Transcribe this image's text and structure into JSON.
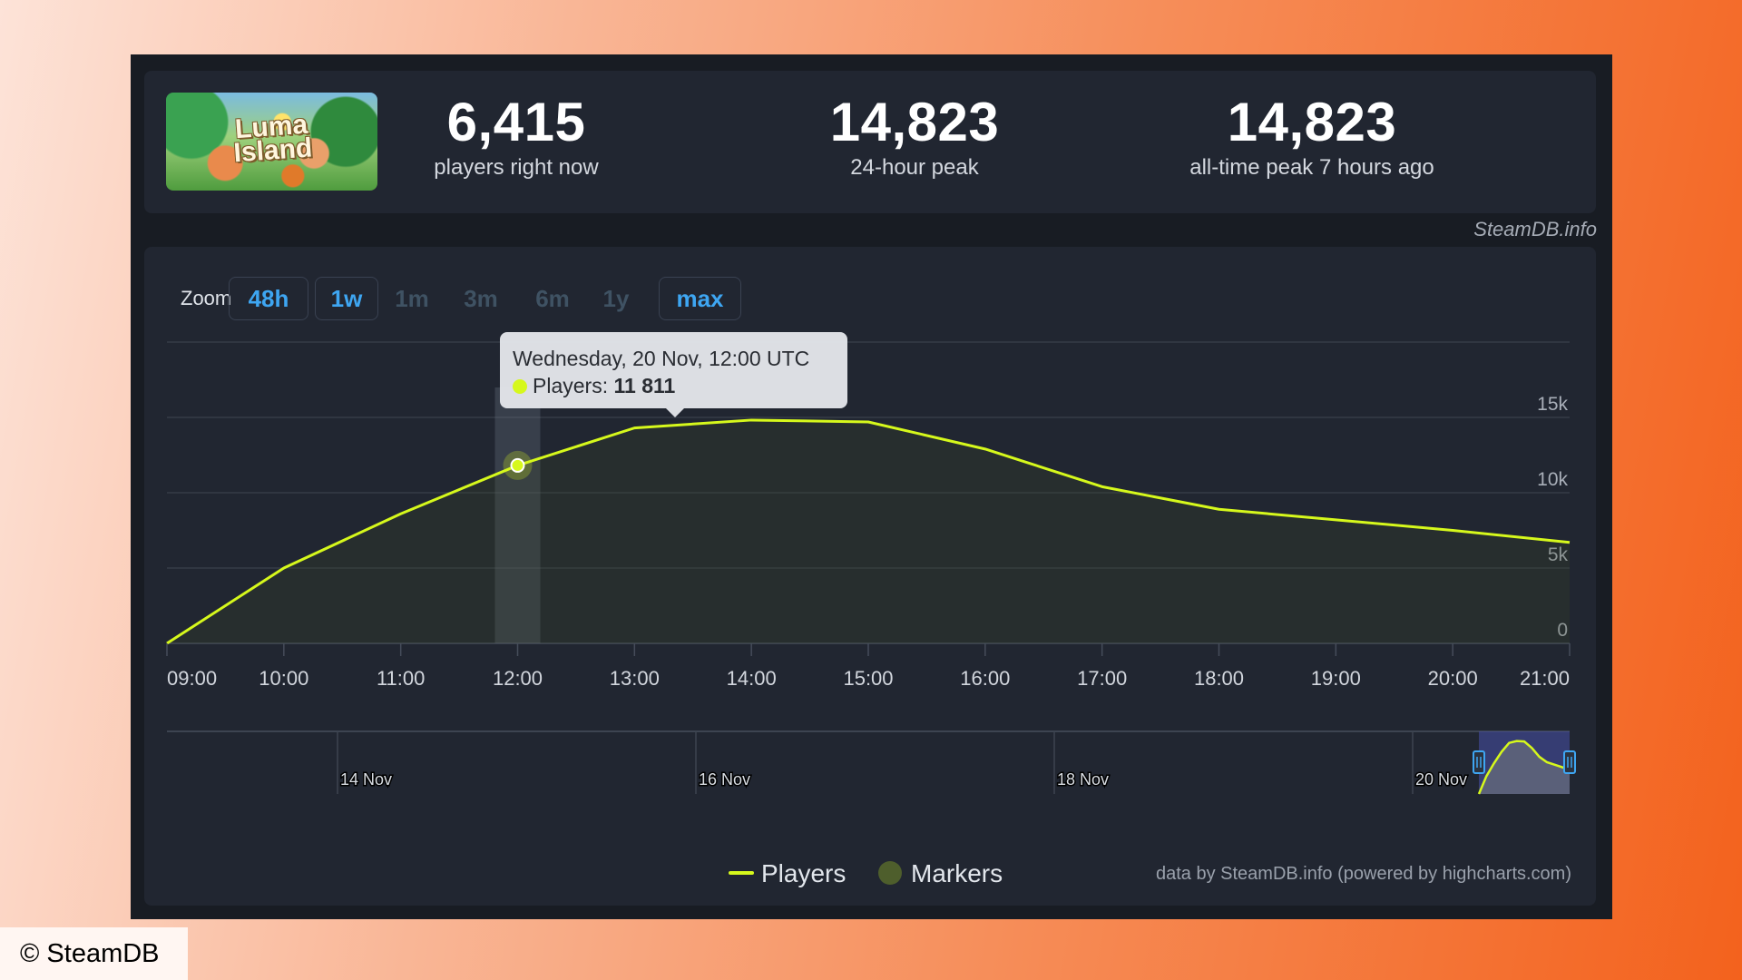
{
  "game": {
    "art_title": "Luma\nIsland",
    "art_alt": "Luma Island key art"
  },
  "stats": [
    {
      "value": "6,415",
      "label": "players right now"
    },
    {
      "value": "14,823",
      "label": "24-hour peak"
    },
    {
      "value": "14,823",
      "label": "all-time peak 7 hours ago"
    }
  ],
  "watermark": "SteamDB.info",
  "zoom": {
    "label": "Zoom",
    "buttons": [
      {
        "label": "48h",
        "active": true
      },
      {
        "label": "1w",
        "active": true
      },
      {
        "label": "1m",
        "active": false
      },
      {
        "label": "3m",
        "active": false
      },
      {
        "label": "6m",
        "active": false
      },
      {
        "label": "1y",
        "active": false
      },
      {
        "label": "max",
        "active": true
      }
    ]
  },
  "tooltip": {
    "header": "Wednesday, 20 Nov, 12:00 UTC",
    "series_label": "Players: ",
    "value": "11 811"
  },
  "legend": [
    {
      "label": "Players"
    },
    {
      "label": "Markers"
    }
  ],
  "credits": "data by SteamDB.info (powered by highcharts.com)",
  "copyright": "© SteamDB",
  "colors": {
    "series": "#d6f81c",
    "markers": "#4e5e2c",
    "accent_blue": "#3ea6f2",
    "background_card": "#212631"
  },
  "chart_data": {
    "type": "area",
    "title": "",
    "xlabel": "",
    "ylabel": "",
    "x": [
      "09:00",
      "10:00",
      "11:00",
      "12:00",
      "13:00",
      "14:00",
      "15:00",
      "16:00",
      "17:00",
      "18:00",
      "19:00",
      "20:00",
      "21:00"
    ],
    "series": [
      {
        "name": "Players",
        "values": [
          0,
          5000,
          8600,
          11811,
          14300,
          14823,
          14700,
          12900,
          10400,
          8900,
          8200,
          7500,
          6700
        ]
      }
    ],
    "ylim": [
      0,
      20000
    ],
    "yticks": [
      0,
      5000,
      10000,
      15000,
      20000
    ],
    "ytick_labels": [
      "0",
      "5k",
      "10k",
      "15k",
      ""
    ],
    "grid": true,
    "legend_position": "bottom-center",
    "highlighted_point": {
      "x": "12:00",
      "value": 11811
    },
    "navigator": {
      "labels": [
        "14 Nov",
        "16 Nov",
        "18 Nov",
        "20 Nov"
      ],
      "selected_range": "last 12 hours"
    }
  }
}
